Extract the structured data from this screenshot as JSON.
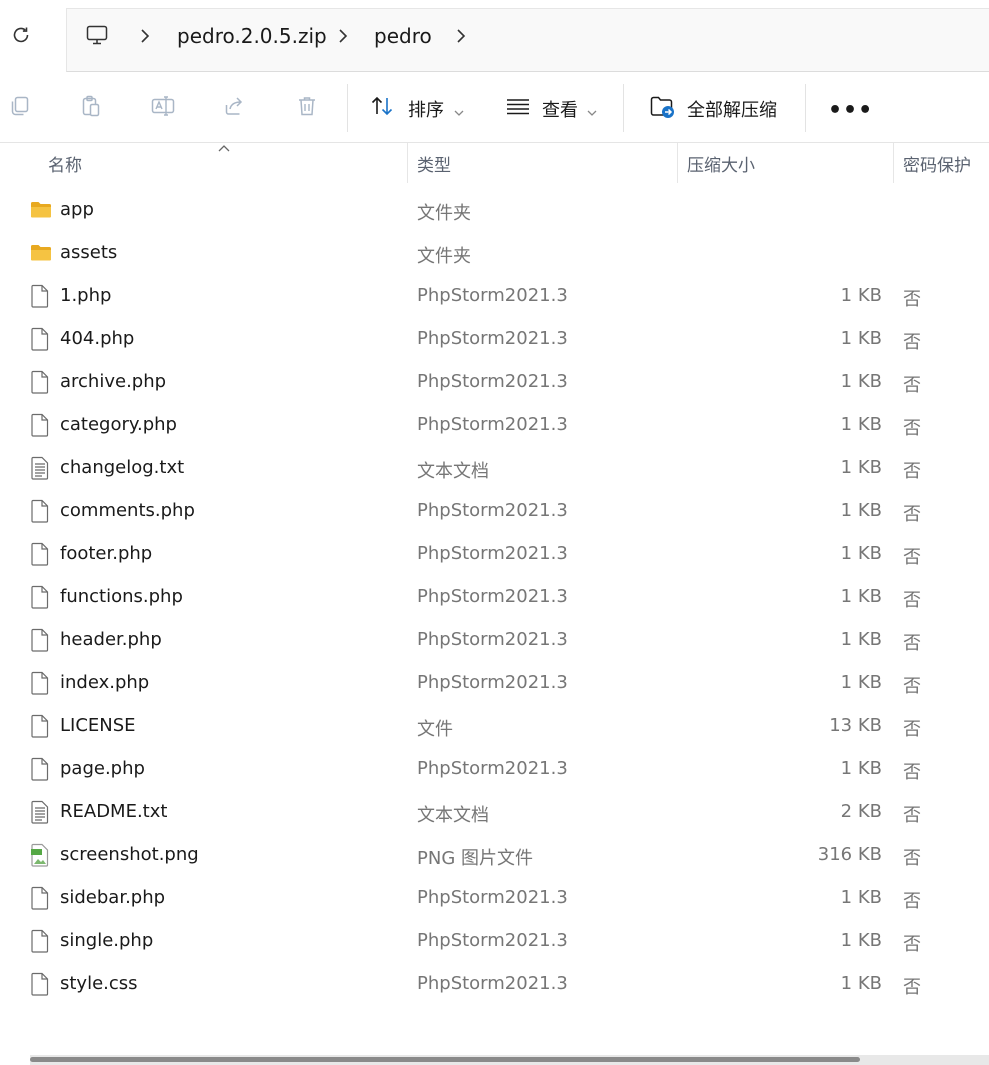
{
  "breadcrumb": {
    "items": [
      "pedro.2.0.5.zip",
      "pedro"
    ]
  },
  "toolbar": {
    "sort_label": "排序",
    "view_label": "查看",
    "extract_label": "全部解压缩",
    "more_label": "•••"
  },
  "columns": {
    "name": "名称",
    "type": "类型",
    "compressed_size": "压缩大小",
    "password": "密码保护"
  },
  "files": [
    {
      "name": "app",
      "kind": "folder",
      "type": "文件夹",
      "size": "",
      "password": ""
    },
    {
      "name": "assets",
      "kind": "folder",
      "type": "文件夹",
      "size": "",
      "password": ""
    },
    {
      "name": "1.php",
      "kind": "file",
      "type": "PhpStorm2021.3",
      "size": "1 KB",
      "password": "否"
    },
    {
      "name": "404.php",
      "kind": "file",
      "type": "PhpStorm2021.3",
      "size": "1 KB",
      "password": "否"
    },
    {
      "name": "archive.php",
      "kind": "file",
      "type": "PhpStorm2021.3",
      "size": "1 KB",
      "password": "否"
    },
    {
      "name": "category.php",
      "kind": "file",
      "type": "PhpStorm2021.3",
      "size": "1 KB",
      "password": "否"
    },
    {
      "name": "changelog.txt",
      "kind": "text",
      "type": "文本文档",
      "size": "1 KB",
      "password": "否"
    },
    {
      "name": "comments.php",
      "kind": "file",
      "type": "PhpStorm2021.3",
      "size": "1 KB",
      "password": "否"
    },
    {
      "name": "footer.php",
      "kind": "file",
      "type": "PhpStorm2021.3",
      "size": "1 KB",
      "password": "否"
    },
    {
      "name": "functions.php",
      "kind": "file",
      "type": "PhpStorm2021.3",
      "size": "1 KB",
      "password": "否"
    },
    {
      "name": "header.php",
      "kind": "file",
      "type": "PhpStorm2021.3",
      "size": "1 KB",
      "password": "否"
    },
    {
      "name": "index.php",
      "kind": "file",
      "type": "PhpStorm2021.3",
      "size": "1 KB",
      "password": "否"
    },
    {
      "name": "LICENSE",
      "kind": "file",
      "type": "文件",
      "size": "13 KB",
      "password": "否"
    },
    {
      "name": "page.php",
      "kind": "file",
      "type": "PhpStorm2021.3",
      "size": "1 KB",
      "password": "否"
    },
    {
      "name": "README.txt",
      "kind": "text",
      "type": "文本文档",
      "size": "2 KB",
      "password": "否"
    },
    {
      "name": "screenshot.png",
      "kind": "image",
      "type": "PNG 图片文件",
      "size": "316 KB",
      "password": "否"
    },
    {
      "name": "sidebar.php",
      "kind": "file",
      "type": "PhpStorm2021.3",
      "size": "1 KB",
      "password": "否"
    },
    {
      "name": "single.php",
      "kind": "file",
      "type": "PhpStorm2021.3",
      "size": "1 KB",
      "password": "否"
    },
    {
      "name": "style.css",
      "kind": "file",
      "type": "PhpStorm2021.3",
      "size": "1 KB",
      "password": "否"
    }
  ],
  "icons": {
    "refresh": "refresh-icon",
    "pc": "this-pc-icon",
    "copy": "copy-icon",
    "paste": "paste-icon",
    "rename": "rename-icon",
    "share": "share-icon",
    "delete": "delete-icon",
    "sort": "sort-icon",
    "view": "view-icon",
    "extract": "extract-all-icon"
  },
  "colors": {
    "folder": "#f5c342",
    "folder_dark": "#e8a920",
    "accent_blue": "#1a73c8"
  }
}
